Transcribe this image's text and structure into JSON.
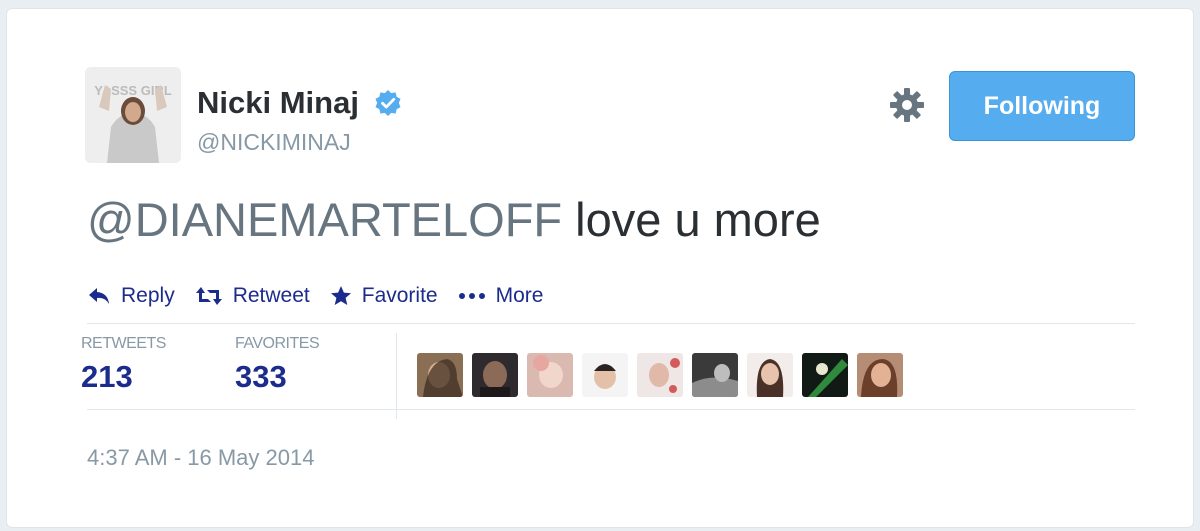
{
  "tweet": {
    "author": {
      "name": "Nicki Minaj",
      "handle": "@NICKIMINAJ",
      "verified_icon": "verified-badge-icon",
      "avatar_text": "YASSS GIRL"
    },
    "follow_button_label": "Following",
    "text": {
      "mention": "@DIANEMARTELOFF",
      "body": " love u more"
    },
    "actions": [
      {
        "label": "Reply",
        "icon": "reply-icon"
      },
      {
        "label": "Retweet",
        "icon": "retweet-icon"
      },
      {
        "label": "Favorite",
        "icon": "star-icon"
      },
      {
        "label": "More",
        "icon": "more-dots-icon"
      }
    ],
    "stats": {
      "retweets_label": "RETWEETS",
      "retweets_count": "213",
      "favorites_label": "FAVORITES",
      "favorites_count": "333"
    },
    "favorited_by_avatars": 9,
    "timestamp": "4:37 AM - 16 May 2014"
  },
  "colors": {
    "accent": "#55acee",
    "link": "#1c2c8c",
    "muted": "#8899a6",
    "text": "#292f33"
  }
}
